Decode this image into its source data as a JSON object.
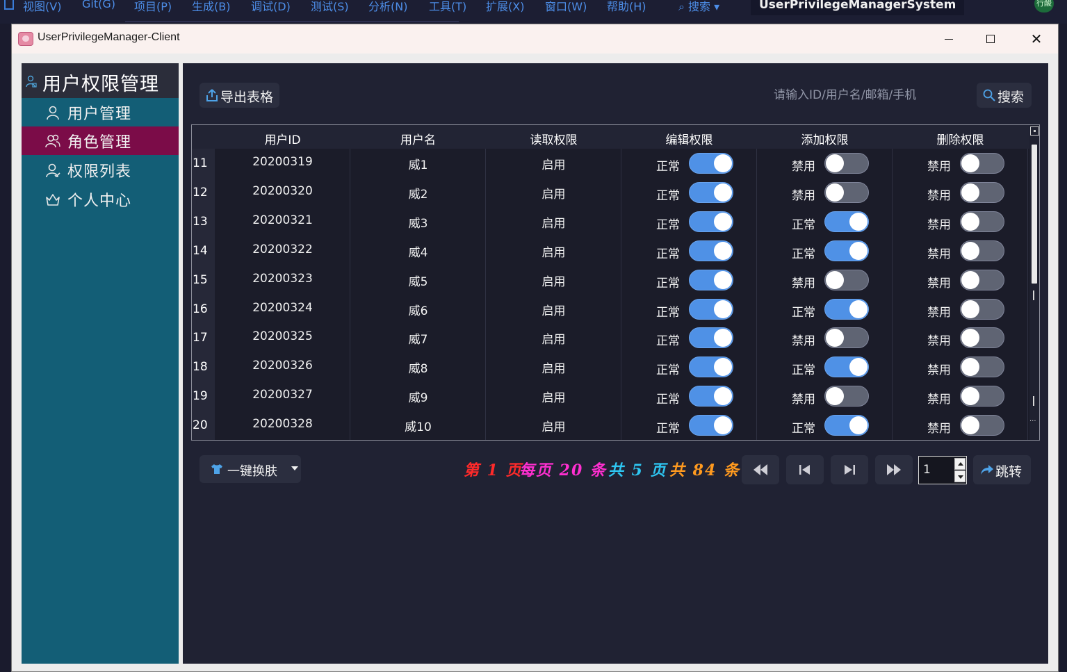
{
  "ide": {
    "menus": [
      "视图(V)",
      "Git(G)",
      "项目(P)",
      "生成(B)",
      "调试(D)",
      "测试(S)",
      "分析(N)",
      "工具(T)",
      "扩展(X)",
      "窗口(W)",
      "帮助(H)"
    ],
    "search_label": "搜索",
    "solution_name": "UserPrivilegeManagerSystem",
    "badge": "行酸"
  },
  "window": {
    "title": "UserPrivilegeManager-Client"
  },
  "sidebar": {
    "title": "用户权限管理",
    "items": [
      {
        "label": "用户管理",
        "icon": "user-icon"
      },
      {
        "label": "角色管理",
        "icon": "users-icon",
        "active": true
      },
      {
        "label": "权限列表",
        "icon": "user-check-icon"
      },
      {
        "label": "个人中心",
        "icon": "crown-icon"
      }
    ]
  },
  "toolbar": {
    "export_label": "导出表格",
    "search_placeholder": "请输入ID/用户名/邮箱/手机",
    "search_label": "搜索"
  },
  "table": {
    "columns": [
      "用户ID",
      "用户名",
      "读取权限",
      "编辑权限",
      "添加权限",
      "删除权限"
    ],
    "rows": [
      {
        "num": "11",
        "id": "20200319",
        "name": "威1",
        "read": "启用",
        "edit": {
          "text": "正常",
          "on": true
        },
        "add": {
          "text": "禁用",
          "on": false
        },
        "delete": {
          "text": "禁用",
          "on": false
        }
      },
      {
        "num": "12",
        "id": "20200320",
        "name": "威2",
        "read": "启用",
        "edit": {
          "text": "正常",
          "on": true
        },
        "add": {
          "text": "禁用",
          "on": false
        },
        "delete": {
          "text": "禁用",
          "on": false
        }
      },
      {
        "num": "13",
        "id": "20200321",
        "name": "威3",
        "read": "启用",
        "edit": {
          "text": "正常",
          "on": true
        },
        "add": {
          "text": "正常",
          "on": true
        },
        "delete": {
          "text": "禁用",
          "on": false
        }
      },
      {
        "num": "14",
        "id": "20200322",
        "name": "威4",
        "read": "启用",
        "edit": {
          "text": "正常",
          "on": true
        },
        "add": {
          "text": "正常",
          "on": true
        },
        "delete": {
          "text": "禁用",
          "on": false
        }
      },
      {
        "num": "15",
        "id": "20200323",
        "name": "威5",
        "read": "启用",
        "edit": {
          "text": "正常",
          "on": true
        },
        "add": {
          "text": "禁用",
          "on": false
        },
        "delete": {
          "text": "禁用",
          "on": false
        }
      },
      {
        "num": "16",
        "id": "20200324",
        "name": "威6",
        "read": "启用",
        "edit": {
          "text": "正常",
          "on": true
        },
        "add": {
          "text": "正常",
          "on": true
        },
        "delete": {
          "text": "禁用",
          "on": false
        }
      },
      {
        "num": "17",
        "id": "20200325",
        "name": "威7",
        "read": "启用",
        "edit": {
          "text": "正常",
          "on": true
        },
        "add": {
          "text": "禁用",
          "on": false
        },
        "delete": {
          "text": "禁用",
          "on": false
        }
      },
      {
        "num": "18",
        "id": "20200326",
        "name": "威8",
        "read": "启用",
        "edit": {
          "text": "正常",
          "on": true
        },
        "add": {
          "text": "正常",
          "on": true
        },
        "delete": {
          "text": "禁用",
          "on": false
        }
      },
      {
        "num": "19",
        "id": "20200327",
        "name": "威9",
        "read": "启用",
        "edit": {
          "text": "正常",
          "on": true
        },
        "add": {
          "text": "禁用",
          "on": false
        },
        "delete": {
          "text": "禁用",
          "on": false
        }
      },
      {
        "num": "20",
        "id": "20200328",
        "name": "威10",
        "read": "启用",
        "edit": {
          "text": "正常",
          "on": true
        },
        "add": {
          "text": "正常",
          "on": true
        },
        "delete": {
          "text": "禁用",
          "on": false
        }
      }
    ]
  },
  "pagination": {
    "skin_label": "一键换肤",
    "page_text": "第 1 页",
    "per_page_text": "每页 20 条",
    "total_pages_text": "共 5 页",
    "total_items_text": "共 84 条",
    "page_input_value": "1",
    "jump_label": "跳转",
    "colors": {
      "page": "#ff2a2a",
      "per_page": "#ff2fd0",
      "total_pages": "#2ec6f2",
      "total_items": "#ff9a1f"
    }
  },
  "colors": {
    "sidebar_bg": "#135e76",
    "sidebar_active": "#7b0c48",
    "toggle_on": "#4f91e6",
    "main_bg": "#202233"
  }
}
